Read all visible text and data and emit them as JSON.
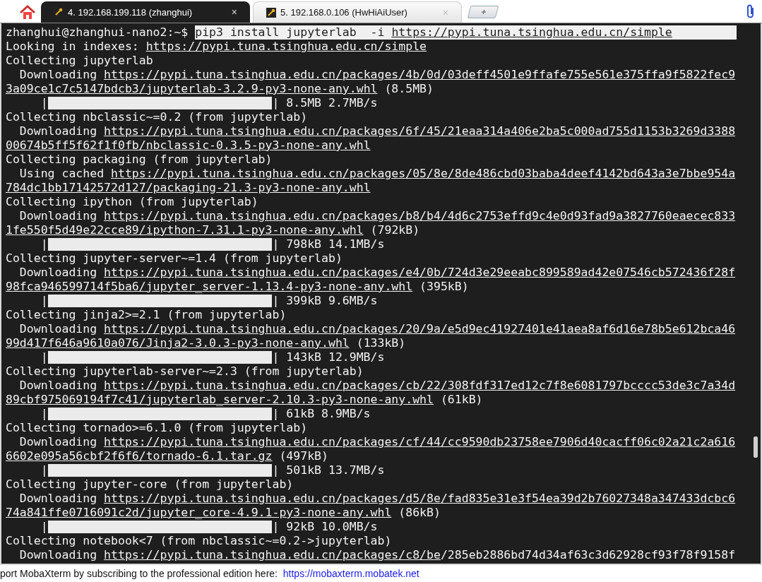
{
  "tabs": [
    {
      "label": "4. 192.168.199.118 (zhanghui)",
      "close": "×",
      "selected": true
    },
    {
      "label": "5. 192.168.0.106 (HwHiAiUser)",
      "close": "×",
      "selected": false
    }
  ],
  "terminal": {
    "lines": [
      {
        "kind": "command",
        "prompt": "zhanghui@zhanghui-nano2:~$ ",
        "selected": true,
        "segments": [
          {
            "text": "pip3 install jupyterlab  -i ",
            "underlined": false
          },
          {
            "text": "https://pypi.tuna.tsinghua.edu.cn/simple",
            "underlined": true
          }
        ]
      },
      {
        "kind": "text",
        "segments": [
          {
            "text": "Looking in indexes: ",
            "underlined": false
          },
          {
            "text": "https://pypi.tuna.tsinghua.edu.cn/simple",
            "underlined": true
          }
        ]
      },
      {
        "kind": "text",
        "segments": [
          {
            "text": "Collecting jupyterlab",
            "underlined": false
          }
        ]
      },
      {
        "kind": "text",
        "segments": [
          {
            "text": "  Downloading ",
            "underlined": false
          },
          {
            "text": "https://pypi.tuna.tsinghua.edu.cn/packages/4b/0d/03deff4501e9ffafe755e561e375ffa9f5822fec9",
            "underlined": true
          }
        ]
      },
      {
        "kind": "text",
        "segments": [
          {
            "text": "3a09ce1c7c5147bdcb3/jupyterlab-3.2.9-py3-none-any.whl",
            "underlined": true
          },
          {
            "text": " (8.5MB)",
            "underlined": false
          }
        ]
      },
      {
        "kind": "progress",
        "start": "|",
        "level": 1,
        "end": "|",
        "reading": "8.5MB 2.7MB/s"
      },
      {
        "kind": "text",
        "segments": [
          {
            "text": "Collecting nbclassic~=0.2 (from jupyterlab)",
            "underlined": false
          }
        ]
      },
      {
        "kind": "text",
        "segments": [
          {
            "text": "  Downloading ",
            "underlined": false
          },
          {
            "text": "https://pypi.tuna.tsinghua.edu.cn/packages/6f/45/21eaa314a406e2ba5c000ad755d1153b3269d3388",
            "underlined": true
          }
        ]
      },
      {
        "kind": "text",
        "segments": [
          {
            "text": "00674b5ff5f62f1f0fb/nbclassic-0.3.5-py3-none-any.whl",
            "underlined": true
          }
        ]
      },
      {
        "kind": "text",
        "segments": [
          {
            "text": "Collecting packaging (from jupyterlab)",
            "underlined": false
          }
        ]
      },
      {
        "kind": "text",
        "segments": [
          {
            "text": "  Using cached ",
            "underlined": false
          },
          {
            "text": "https://pypi.tuna.tsinghua.edu.cn/packages/05/8e/8de486cbd03baba4deef4142bd643a3e7bbe954a",
            "underlined": true
          }
        ]
      },
      {
        "kind": "text",
        "segments": [
          {
            "text": "784dc1bb17142572d127/packaging-21.3-py3-none-any.whl",
            "underlined": true
          }
        ]
      },
      {
        "kind": "text",
        "segments": [
          {
            "text": "Collecting ipython (from jupyterlab)",
            "underlined": false
          }
        ]
      },
      {
        "kind": "text",
        "segments": [
          {
            "text": "  Downloading ",
            "underlined": false
          },
          {
            "text": "https://pypi.tuna.tsinghua.edu.cn/packages/b8/b4/4d6c2753effd9c4e0d93fad9a3827760eaecec833",
            "underlined": true
          }
        ]
      },
      {
        "kind": "text",
        "segments": [
          {
            "text": "1fe550f5d49e22cce89/ipython-7.31.1-py3-none-any.whl",
            "underlined": true
          },
          {
            "text": " (792kB)",
            "underlined": false
          }
        ]
      },
      {
        "kind": "progress",
        "start": "|",
        "level": 1,
        "end": "|",
        "reading": "798kB 14.1MB/s"
      },
      {
        "kind": "text",
        "segments": [
          {
            "text": "Collecting jupyter-server~=1.4 (from jupyterlab)",
            "underlined": false
          }
        ]
      },
      {
        "kind": "text",
        "segments": [
          {
            "text": "  Downloading ",
            "underlined": false
          },
          {
            "text": "https://pypi.tuna.tsinghua.edu.cn/packages/e4/0b/724d3e29eeabc899589ad42e07546cb572436f28f",
            "underlined": true
          }
        ]
      },
      {
        "kind": "text",
        "segments": [
          {
            "text": "98fca946599714f5ba6/jupyter_server-1.13.4-py3-none-any.whl",
            "underlined": true
          },
          {
            "text": " (395kB)",
            "underlined": false
          }
        ]
      },
      {
        "kind": "progress",
        "start": "|",
        "level": 1,
        "end": "|",
        "reading": "399kB 9.6MB/s"
      },
      {
        "kind": "text",
        "segments": [
          {
            "text": "Collecting jinja2>=2.1 (from jupyterlab)",
            "underlined": false
          }
        ]
      },
      {
        "kind": "text",
        "segments": [
          {
            "text": "  Downloading ",
            "underlined": false
          },
          {
            "text": "https://pypi.tuna.tsinghua.edu.cn/packages/20/9a/e5d9ec41927401e41aea8af6d16e78b5e612bca46",
            "underlined": true
          }
        ]
      },
      {
        "kind": "text",
        "segments": [
          {
            "text": "99d417f646a9610a076/Jinja2-3.0.3-py3-none-any.whl",
            "underlined": true
          },
          {
            "text": " (133kB)",
            "underlined": false
          }
        ]
      },
      {
        "kind": "progress",
        "start": "|",
        "level": 1,
        "end": "|",
        "reading": "143kB 12.9MB/s"
      },
      {
        "kind": "text",
        "segments": [
          {
            "text": "Collecting jupyterlab-server~=2.3 (from jupyterlab)",
            "underlined": false
          }
        ]
      },
      {
        "kind": "text",
        "segments": [
          {
            "text": "  Downloading ",
            "underlined": false
          },
          {
            "text": "https://pypi.tuna.tsinghua.edu.cn/packages/cb/22/308fdf317ed12c7f8e6081797bcccc53de3c7a34d",
            "underlined": true
          }
        ]
      },
      {
        "kind": "text",
        "segments": [
          {
            "text": "89cbf975069194f7c41/jupyterlab_server-2.10.3-py3-none-any.whl",
            "underlined": true
          },
          {
            "text": " (61kB)",
            "underlined": false
          }
        ]
      },
      {
        "kind": "progress",
        "start": "|",
        "level": 1,
        "end": "|",
        "reading": "61kB 8.9MB/s"
      },
      {
        "kind": "text",
        "segments": [
          {
            "text": "Collecting tornado>=6.1.0 (from jupyterlab)",
            "underlined": false
          }
        ]
      },
      {
        "kind": "text",
        "segments": [
          {
            "text": "  Downloading ",
            "underlined": false
          },
          {
            "text": "https://pypi.tuna.tsinghua.edu.cn/packages/cf/44/cc9590db23758ee7906d40cacff06c02a21c2a616",
            "underlined": true
          }
        ]
      },
      {
        "kind": "text",
        "segments": [
          {
            "text": "6602e095a56cbf2f6f6/tornado-6.1.tar.gz",
            "underlined": true
          },
          {
            "text": " (497kB)",
            "underlined": false
          }
        ]
      },
      {
        "kind": "progress",
        "start": "|",
        "level": 1,
        "end": "|",
        "reading": "501kB 13.7MB/s"
      },
      {
        "kind": "text",
        "segments": [
          {
            "text": "Collecting jupyter-core (from jupyterlab)",
            "underlined": false
          }
        ]
      },
      {
        "kind": "text",
        "segments": [
          {
            "text": "  Downloading ",
            "underlined": false
          },
          {
            "text": "https://pypi.tuna.tsinghua.edu.cn/packages/d5/8e/fad835e31e3f54ea39d2b76027348a347433dcbc6",
            "underlined": true
          }
        ]
      },
      {
        "kind": "text",
        "segments": [
          {
            "text": "74a841ffe0716091c2d/jupyter_core-4.9.1-py3-none-any.whl",
            "underlined": true
          },
          {
            "text": " (86kB)",
            "underlined": false
          }
        ]
      },
      {
        "kind": "progress",
        "start": "|",
        "level": 1,
        "end": "|",
        "reading": "92kB 10.0MB/s"
      },
      {
        "kind": "text",
        "segments": [
          {
            "text": "Collecting notebook<7 (from nbclassic~=0.2->jupyterlab)",
            "underlined": false
          }
        ]
      },
      {
        "kind": "text",
        "segments": [
          {
            "text": "  Downloading ",
            "underlined": false
          },
          {
            "text": "https://pypi.tuna.tsinghua.edu.cn/packages/c8/be",
            "underlined": true
          },
          {
            "text": "/285eb2886bd74d34af63c3d62928cf93f78f9158f",
            "underlined": false
          }
        ]
      }
    ]
  },
  "status_bar": {
    "text": "port MobaXterm by subscribing to the professional edition here: ",
    "link": "https://mobaxterm.mobatek.net"
  }
}
